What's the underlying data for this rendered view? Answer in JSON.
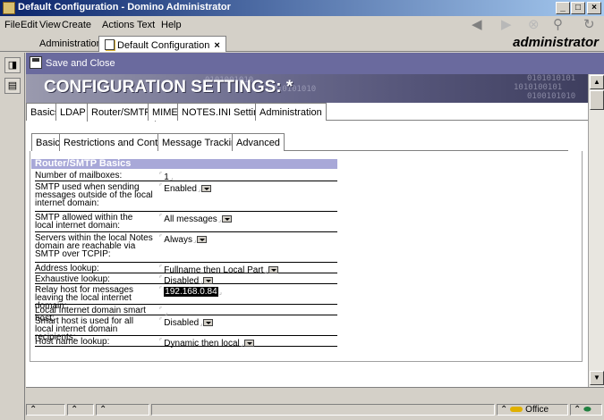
{
  "window": {
    "title": "Default Configuration - Domino Administrator",
    "controls": {
      "minimize": "_",
      "maximize": "□",
      "close": "×"
    }
  },
  "menu": [
    "File",
    "Edit",
    "View",
    "Create",
    "Actions",
    "Text",
    "Help"
  ],
  "toolbar_icons": [
    "back-arrow-icon",
    "forward-arrow-icon",
    "stop-icon",
    "search-icon",
    "refresh-icon"
  ],
  "window_tabs": [
    {
      "label": "Administration",
      "active": false
    },
    {
      "label": "Default Configuration",
      "active": true,
      "close": "×"
    }
  ],
  "user_label": "administrator",
  "action_bar": {
    "save_close": "Save and Close"
  },
  "banner": {
    "title": "CONFIGURATION SETTINGS: *",
    "binary_lines": [
      "0101001010",
      "1010101010",
      "0101010101",
      "1010100101",
      "0100101010"
    ]
  },
  "form_tabs": [
    "Basics",
    "LDAP",
    "Router/SMTP",
    "MIME",
    "NOTES.INI Settings",
    "Administration"
  ],
  "active_form_tab": "Router/SMTP",
  "sub_tabs": [
    "Basics",
    "Restrictions and Controls",
    "Message Tracking",
    "Advanced"
  ],
  "active_sub_tab": "Basics",
  "section": {
    "header": "Router/SMTP Basics",
    "fields": [
      {
        "label": "Number of mailboxes:",
        "value": "1",
        "dropdown": false
      },
      {
        "label": "SMTP used when sending messages outside of the local internet domain:",
        "value": "Enabled",
        "dropdown": true
      },
      {
        "label": "SMTP allowed within the local internet domain:",
        "value": "All messages",
        "dropdown": true
      },
      {
        "label": "Servers within the local Notes domain are reachable via SMTP over TCPIP:",
        "value": "Always",
        "dropdown": true
      },
      {
        "label": "Address lookup:",
        "value": "Fullname then Local Part",
        "dropdown": true
      },
      {
        "label": "Exhaustive lookup:",
        "value": "Disabled",
        "dropdown": true
      },
      {
        "label": "Relay host for messages leaving the local internet domain:",
        "value": "192.168.0.84",
        "dropdown": false,
        "selected": true
      },
      {
        "label": "Local Internet domain smart host:",
        "value": "",
        "dropdown": false
      },
      {
        "label": "Smart host is used for all local internet domain recipients:",
        "value": "Disabled",
        "dropdown": true
      },
      {
        "label": "Host name lookup:",
        "value": "Dynamic then local",
        "dropdown": true
      }
    ]
  },
  "status_bar": {
    "location": "Office"
  }
}
